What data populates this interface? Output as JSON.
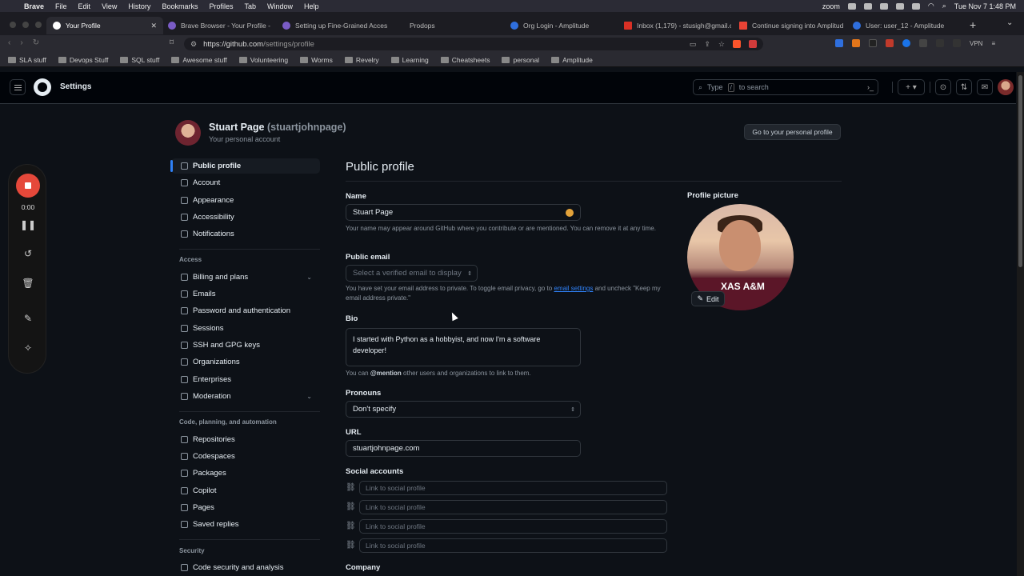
{
  "menubar": {
    "items": [
      "Brave",
      "File",
      "Edit",
      "View",
      "History",
      "Bookmarks",
      "Profiles",
      "Tab",
      "Window",
      "Help"
    ],
    "zoom": "zoom",
    "datetime": "Tue Nov 7  1:48 PM"
  },
  "tabs": [
    {
      "label": "Your Profile",
      "active": true
    },
    {
      "label": "Brave Browser - Your Profile -"
    },
    {
      "label": "Setting up Fine-Grained Acces"
    },
    {
      "label": "Prodops"
    },
    {
      "label": "Org Login - Amplitude"
    },
    {
      "label": "Inbox (1,179) - stusigh@gmail.c"
    },
    {
      "label": "Continue signing into Amplitud"
    },
    {
      "label": "User: user_12 - Amplitude"
    }
  ],
  "url": {
    "host": "https://github.com",
    "path": "/settings/profile"
  },
  "vpn": "VPN",
  "bookmarks": [
    "SLA stuff",
    "Devops Stuff",
    "SQL stuff",
    "Awesome stuff",
    "Volunteering",
    "Worms",
    "Revelry",
    "Learning",
    "Cheatsheets",
    "personal",
    "Amplitude"
  ],
  "github": {
    "title": "Settings",
    "search_prefix": "Type",
    "search_key": "/",
    "search_suffix": "to search"
  },
  "recorder": {
    "time": "0:00"
  },
  "profile": {
    "name": "Stuart Page",
    "handle": "(stuartjohnpage)",
    "subtitle": "Your personal account",
    "goto_button": "Go to your personal profile"
  },
  "sidebar": {
    "items_top": [
      "Public profile",
      "Account",
      "Appearance",
      "Accessibility",
      "Notifications"
    ],
    "access_heading": "Access",
    "access_items": [
      "Billing and plans",
      "Emails",
      "Password and authentication",
      "Sessions",
      "SSH and GPG keys",
      "Organizations",
      "Enterprises",
      "Moderation"
    ],
    "code_heading": "Code, planning, and automation",
    "code_items": [
      "Repositories",
      "Codespaces",
      "Packages",
      "Copilot",
      "Pages",
      "Saved replies"
    ],
    "security_heading": "Security",
    "security_items": [
      "Code security and analysis"
    ]
  },
  "form": {
    "title": "Public profile",
    "name_label": "Name",
    "name_value": "Stuart Page",
    "name_note": "Your name may appear around GitHub where you contribute or are mentioned. You can remove it at any time.",
    "email_label": "Public email",
    "email_placeholder": "Select a verified email to display",
    "email_note_pre": "You have set your email address to private. To toggle email privacy, go to",
    "email_note_link": "email settings",
    "email_note_post": "and uncheck \"Keep my email address private.\"",
    "bio_label": "Bio",
    "bio_value": "I started with Python as a hobbyist, and now I'm a software developer!",
    "bio_note_pre": "You can",
    "bio_note_bold": "@mention",
    "bio_note_post": "other users and organizations to link to them.",
    "pronouns_label": "Pronouns",
    "pronouns_value": "Don't specify",
    "url_label": "URL",
    "url_value": "stuartjohnpage.com",
    "social_label": "Social accounts",
    "social_placeholder": "Link to social profile",
    "company_label": "Company"
  },
  "picture": {
    "label": "Profile picture",
    "edit": "Edit",
    "shirt_text": "XAS A&M"
  }
}
